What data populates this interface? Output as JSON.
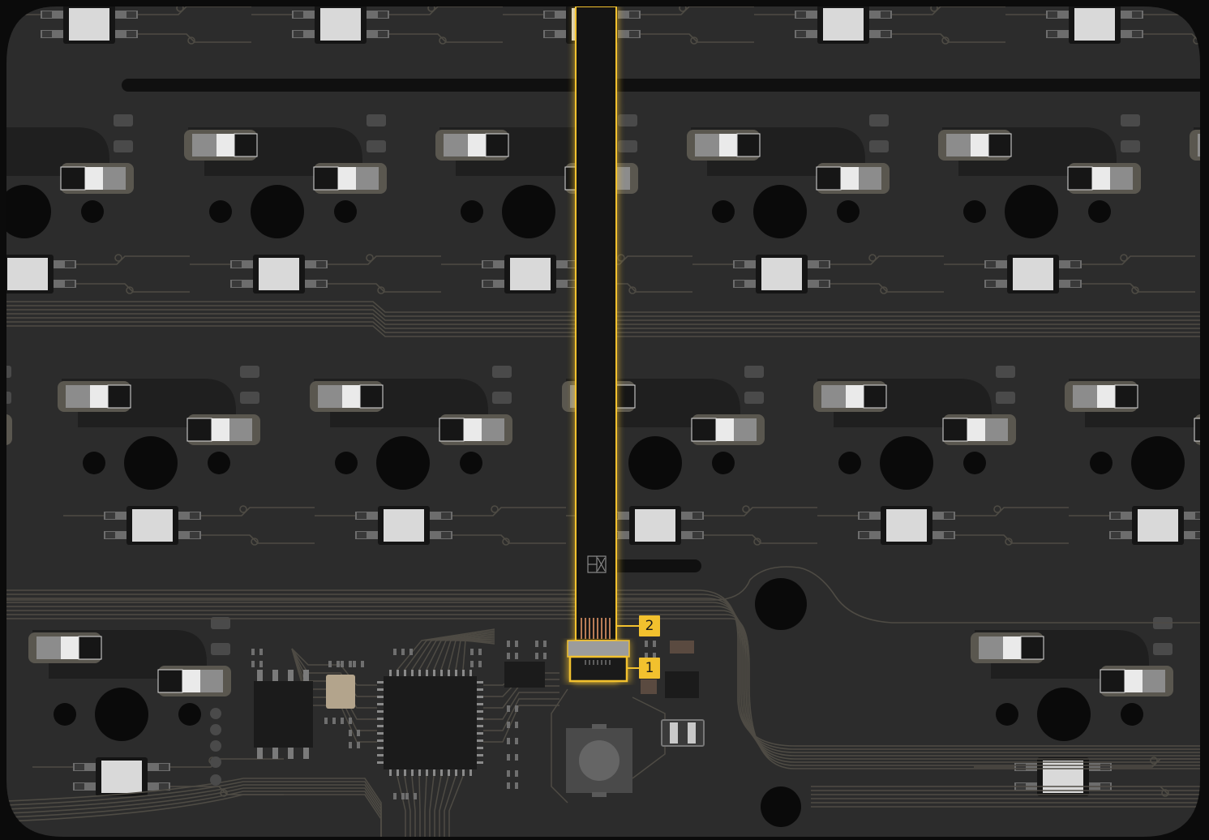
{
  "view": {
    "description_free": true,
    "colors": {
      "background": "#0b0b0b",
      "pcb": "#2c2c2c",
      "trace": "#4e4b44",
      "pad": "#d9d9d9",
      "hole": "#0a0a0a",
      "highlight": "#f2c12e",
      "ribbon": "#151515",
      "chip": "#1b1b1b"
    }
  },
  "callouts": [
    {
      "id": "callout-2",
      "label": "2",
      "target": "ribbon-cable-contacts"
    },
    {
      "id": "callout-1",
      "label": "1",
      "target": "fpc-connector"
    }
  ],
  "components": {
    "ribbon_cable": {
      "icon": "ribbon-cable",
      "marking_icon": "fpc-marking-icon",
      "highlighted": true
    },
    "connector": {
      "icon": "fpc-connector",
      "highlighted": true
    },
    "reset_switch": {
      "icon": "tactile-switch"
    },
    "mcu": {
      "icon": "qfn-chip"
    },
    "flash": {
      "icon": "soic-chip"
    }
  }
}
